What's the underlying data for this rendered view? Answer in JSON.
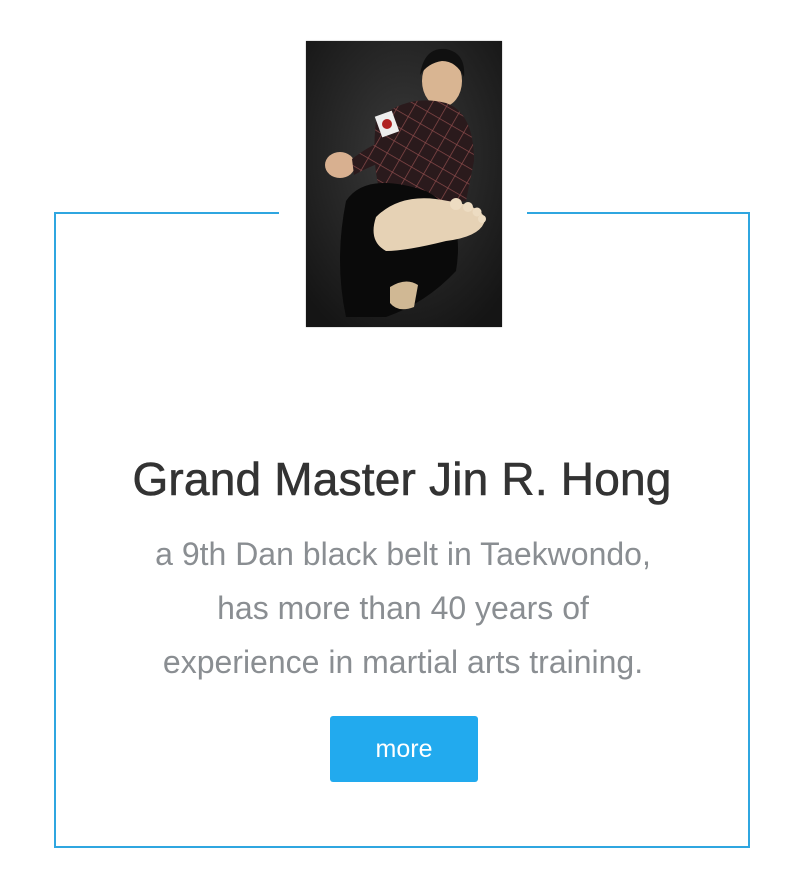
{
  "profile": {
    "name": "Grand Master Jin R. Hong",
    "bio_lines": [
      "a 9th Dan black belt in Taekwondo,",
      "has more than 40 years of",
      "experience in martial arts training."
    ],
    "more_label": "more",
    "photo": "martial-arts-kick-photo"
  },
  "colors": {
    "frame": "#2fa6e0",
    "button": "#22aaee",
    "title": "#333333",
    "body_text": "#8a8e92"
  }
}
